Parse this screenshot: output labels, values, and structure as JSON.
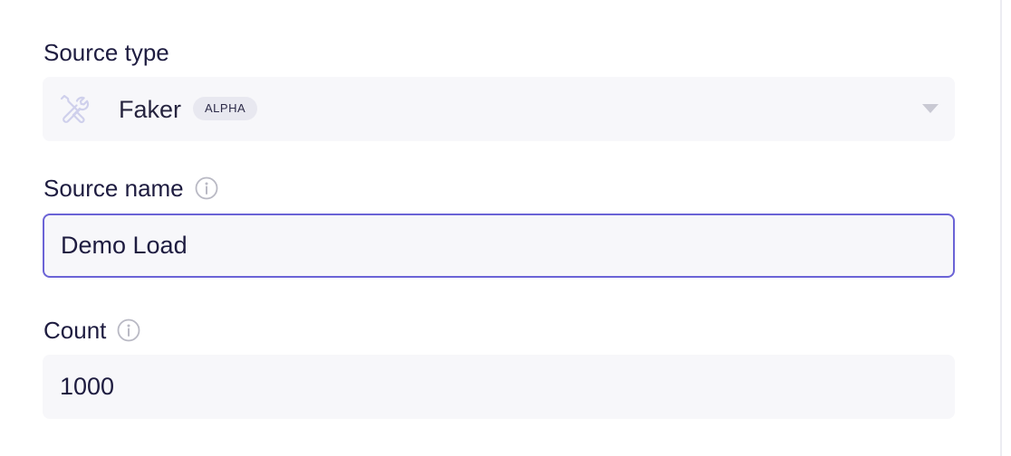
{
  "source_type": {
    "label": "Source type",
    "value": "Faker",
    "badge": "ALPHA",
    "icon": "tools-icon"
  },
  "source_name": {
    "label": "Source name",
    "value": "Demo Load",
    "info_icon": "info-icon"
  },
  "count": {
    "label": "Count",
    "value": "1000",
    "info_icon": "info-icon"
  },
  "colors": {
    "focus_border": "#6b63d6",
    "field_bg": "#f7f7fa",
    "label_text": "#1e1c40"
  }
}
